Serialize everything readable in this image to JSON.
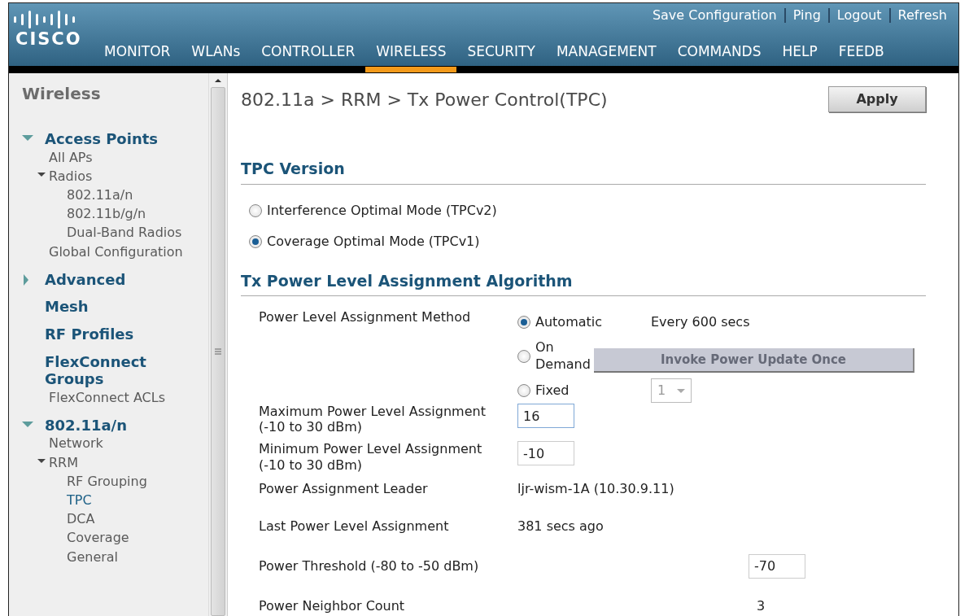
{
  "header": {
    "logo": "CISCO",
    "top_links": [
      "Save Configuration",
      "Ping",
      "Logout",
      "Refresh"
    ],
    "menu": [
      {
        "label": "MONITOR",
        "selected": false
      },
      {
        "label": "WLANs",
        "selected": false
      },
      {
        "label": "CONTROLLER",
        "selected": false
      },
      {
        "label": "WIRELESS",
        "selected": true
      },
      {
        "label": "SECURITY",
        "selected": false
      },
      {
        "label": "MANAGEMENT",
        "selected": false
      },
      {
        "label": "COMMANDS",
        "selected": false
      },
      {
        "label": "HELP",
        "selected": false
      },
      {
        "label": "FEEDB",
        "selected": false
      }
    ]
  },
  "sidebar": {
    "title": "Wireless",
    "sections": [
      {
        "label": "Access Points",
        "expanded": true,
        "children": [
          {
            "label": "All APs",
            "selected": false
          },
          {
            "label": "Radios",
            "expanded": true,
            "children": [
              {
                "label": "802.11a/n",
                "selected": false
              },
              {
                "label": "802.11b/g/n",
                "selected": false
              },
              {
                "label": "Dual-Band Radios",
                "selected": false
              }
            ]
          },
          {
            "label": "Global Configuration",
            "selected": false
          }
        ]
      },
      {
        "label": "Advanced",
        "expanded": false
      },
      {
        "label": "Mesh"
      },
      {
        "label": "RF Profiles"
      },
      {
        "label": "FlexConnect Groups",
        "children": [
          {
            "label": "FlexConnect ACLs",
            "selected": false
          }
        ]
      },
      {
        "label": "802.11a/n",
        "expanded": true,
        "children": [
          {
            "label": "Network",
            "selected": false
          },
          {
            "label": "RRM",
            "expanded": true,
            "children": [
              {
                "label": "RF Grouping",
                "selected": false
              },
              {
                "label": "TPC",
                "selected": true
              },
              {
                "label": "DCA",
                "selected": false
              },
              {
                "label": "Coverage",
                "selected": false
              },
              {
                "label": "General",
                "selected": false
              }
            ]
          }
        ]
      }
    ]
  },
  "content": {
    "title": "802.11a > RRM > Tx Power Control(TPC)",
    "apply_button": "Apply",
    "tpc_version": {
      "heading": "TPC Version",
      "options": [
        {
          "label": "Interference Optimal Mode (TPCv2)",
          "selected": false
        },
        {
          "label": "Coverage Optimal Mode (TPCv1)",
          "selected": true
        }
      ]
    },
    "algorithm": {
      "heading": "Tx Power Level Assignment Algorithm",
      "rows": [
        {
          "kind": "method",
          "label": "Power Level Assignment Method",
          "options": [
            {
              "kind": "reading",
              "label": "Automatic",
              "selected": true,
              "text": "Every 600 secs"
            },
            {
              "kind": "button",
              "label": "On Demand",
              "selected": false,
              "button": {
                "label": "Invoke Power Update Once",
                "disabled": true
              }
            },
            {
              "kind": "select",
              "label": "Fixed",
              "selected": false,
              "select": {
                "value": "1",
                "disabled": true
              }
            }
          ]
        },
        {
          "kind": "field",
          "label": "Maximum Power Level Assignment (-10 to 30 dBm)",
          "value": "16",
          "focused": true
        },
        {
          "kind": "field",
          "label": "Minimum Power Level Assignment (-10 to 30 dBm)",
          "value": "-10",
          "focused": false
        },
        {
          "kind": "reading",
          "label": "Power Assignment Leader",
          "value": "ljr-wism-1A (10.30.9.11)"
        },
        {
          "kind": "reading",
          "label": "Last Power Level Assignment",
          "value": "381 secs ago"
        },
        {
          "kind": "far-field",
          "label": "Power Threshold (-80 to -50 dBm)",
          "value": "-70",
          "focused": false
        },
        {
          "kind": "far-reading",
          "label": "Power Neighbor Count",
          "value": "3"
        }
      ]
    }
  }
}
